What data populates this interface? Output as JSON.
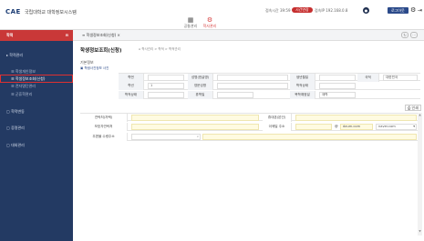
{
  "header": {
    "logo": "CAE",
    "logo_sub": "국립대학교 대학정보시스템",
    "menu": [
      {
        "label": "공통관리",
        "icon": "grid-icon"
      },
      {
        "label": "학사관리",
        "icon": "gear-icon"
      }
    ],
    "info1": "접속시간 39:59",
    "session_pill": "시간연장",
    "info2": "접속IP 192.168.0.8",
    "logout": "로그아웃",
    "accent": "#c93838"
  },
  "sidebar": {
    "title": "학적",
    "items": [
      {
        "label": "학적관리",
        "sub": false,
        "selected": false
      },
      {
        "label": "학생개인정보",
        "sub": true,
        "selected": false
      },
      {
        "label": "학생정보조회(신청)",
        "sub": true,
        "selected": true
      },
      {
        "label": "전자명단관리",
        "sub": true,
        "selected": false
      },
      {
        "label": "군휴학관리",
        "sub": true,
        "selected": false
      },
      {
        "label": "학적변동",
        "sub": false,
        "selected": false
      },
      {
        "label": "증명관리",
        "sub": false,
        "selected": false
      },
      {
        "label": "대외관리",
        "sub": false,
        "selected": false
      }
    ],
    "bg": "#233a63"
  },
  "tabs": {
    "active": "학생정보조회(신청)"
  },
  "page": {
    "title": "학생정보조회(신청)",
    "breadcrumb": "학사관리 > 학적 > 학적관리",
    "section1": "기본정보",
    "photo_label": "학생사진정보 사진",
    "print": "인쇄"
  },
  "form": {
    "rows": [
      [
        {
          "label": "학번",
          "value": ""
        },
        {
          "label": "성명(한글명)",
          "value": ""
        },
        {
          "label": "생년월일",
          "value": ""
        },
        {
          "label": "국적",
          "value": "대한민국"
        }
      ],
      [
        {
          "label": "학년",
          "value": "1"
        },
        {
          "label": "영문성명",
          "value": ""
        },
        {
          "label": "학적상태",
          "value": ""
        }
      ],
      [
        {
          "label": "학적상태",
          "value": ""
        },
        {
          "label": "휴학일",
          "value": ""
        },
        {
          "label": "복학예정일",
          "value": "재학"
        }
      ]
    ]
  },
  "form2": {
    "phone_label": "연락처(자택)",
    "mobile_label": "휴대폰(본인)",
    "guardian_label": "보호자연락처",
    "email_label": "이메일 주소",
    "email_domain1": "daum.com",
    "email_domain2": "naver.com",
    "email_at": "@",
    "address_label": "우편물 수령주소"
  }
}
